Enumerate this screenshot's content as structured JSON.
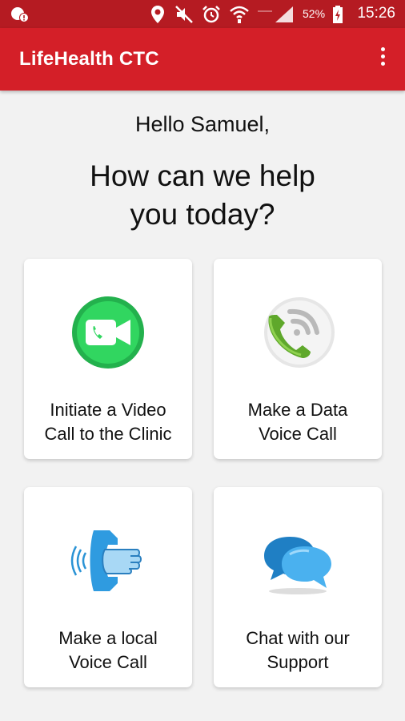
{
  "status_bar": {
    "battery_percent": "52%",
    "time": "15:26",
    "icons": [
      "notification-icon",
      "location-icon",
      "mute-icon",
      "alarm-icon",
      "wifi-icon",
      "signal-icon",
      "battery-icon"
    ]
  },
  "app_bar": {
    "title": "LifeHealth CTC",
    "menu_icon": "overflow-menu-icon"
  },
  "greeting": "Hello Samuel,",
  "question": "How can we help you today?",
  "options": [
    {
      "line1": "Initiate a Video",
      "line2": "Call to the Clinic",
      "icon": "video-call-icon"
    },
    {
      "line1": "Make a Data",
      "line2": "Voice Call",
      "icon": "data-voice-call-icon"
    },
    {
      "line1": "Make a local",
      "line2": "Voice Call",
      "icon": "local-voice-call-icon"
    },
    {
      "line1": "Chat with our",
      "line2": "Support",
      "icon": "chat-icon"
    }
  ],
  "colors": {
    "status_bar": "#b51b22",
    "app_bar": "#d41f28",
    "background": "#f2f2f2"
  }
}
